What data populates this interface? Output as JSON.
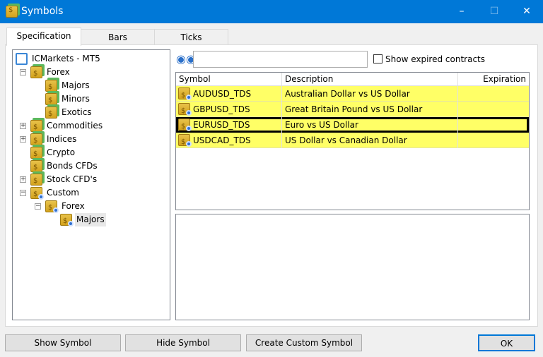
{
  "window": {
    "title": "Symbols",
    "icon": "symbols-icon"
  },
  "tabs": [
    {
      "label": "Specification",
      "active": true
    },
    {
      "label": "Bars"
    },
    {
      "label": "Ticks"
    }
  ],
  "tree": [
    {
      "label": "ICMarkets - MT5",
      "level": 0,
      "icon": "server-icon"
    },
    {
      "label": "Forex",
      "level": 1,
      "expander": "minus"
    },
    {
      "label": "Majors",
      "level": 2
    },
    {
      "label": "Minors",
      "level": 2
    },
    {
      "label": "Exotics",
      "level": 2
    },
    {
      "label": "Commodities",
      "level": 1,
      "expander": "plus"
    },
    {
      "label": "Indices",
      "level": 1,
      "expander": "plus"
    },
    {
      "label": "Crypto",
      "level": 1
    },
    {
      "label": "Bonds CFDs",
      "level": 1
    },
    {
      "label": "Stock CFD's",
      "level": 1,
      "expander": "plus"
    },
    {
      "label": "Custom",
      "level": 1,
      "expander": "minus",
      "custom": true
    },
    {
      "label": "Forex",
      "level": 2,
      "expander": "minus",
      "custom": true
    },
    {
      "label": "Majors",
      "level": 3,
      "custom": true,
      "selected": true
    }
  ],
  "search": {
    "value": "",
    "show_expired_label": "Show expired contracts",
    "show_expired_checked": false
  },
  "table": {
    "headers": [
      "Symbol",
      "Description",
      "Expiration"
    ],
    "rows": [
      {
        "symbol": "AUDUSD_TDS",
        "description": "Australian Dollar vs US Dollar",
        "expiration": ""
      },
      {
        "symbol": "GBPUSD_TDS",
        "description": "Great Britain Pound vs US Dollar",
        "expiration": ""
      },
      {
        "symbol": "EURUSD_TDS",
        "description": "Euro vs US Dollar",
        "expiration": "",
        "selected": true
      },
      {
        "symbol": "USDCAD_TDS",
        "description": "US Dollar vs Canadian Dollar",
        "expiration": ""
      }
    ],
    "highlight_color": "#ffff66"
  },
  "buttons": {
    "show": "Show Symbol",
    "hide": "Hide Symbol",
    "create": "Create Custom Symbol",
    "ok": "OK"
  }
}
